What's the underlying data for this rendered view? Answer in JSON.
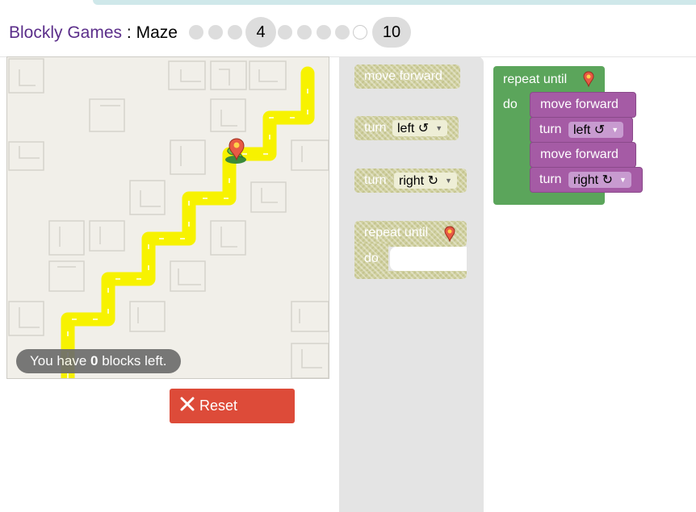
{
  "header": {
    "app_name": "Blockly Games",
    "separator": ":",
    "game_name": "Maze",
    "levels": [
      {
        "label": "",
        "type": "dot"
      },
      {
        "label": "",
        "type": "dot"
      },
      {
        "label": "",
        "type": "dot"
      },
      {
        "label": "4",
        "type": "current"
      },
      {
        "label": "",
        "type": "dot"
      },
      {
        "label": "",
        "type": "dot"
      },
      {
        "label": "",
        "type": "dot"
      },
      {
        "label": "",
        "type": "dot"
      },
      {
        "label": "",
        "type": "ring"
      },
      {
        "label": "10",
        "type": "last"
      }
    ]
  },
  "maze": {
    "capsule": {
      "prefix": "You have",
      "count": "0",
      "suffix": "blocks left."
    },
    "pegman_icon": "pegman-icon",
    "marker_icon": "map-marker-icon"
  },
  "reset_button": {
    "label": "Reset",
    "icon": "close-icon"
  },
  "toolbox": {
    "blocks": [
      {
        "text": "move forward"
      },
      {
        "text": "turn",
        "dropdown": "left ↺"
      },
      {
        "text": "turn",
        "dropdown": "right ↻"
      },
      {
        "text": "repeat until",
        "do": "do"
      }
    ]
  },
  "workspace": {
    "repeat_label": "repeat until",
    "do_label": "do",
    "statements": [
      {
        "text": "move forward"
      },
      {
        "text": "turn",
        "dropdown": "left ↺"
      },
      {
        "text": "move forward"
      },
      {
        "text": "turn",
        "dropdown": "right ↻"
      }
    ]
  },
  "colors": {
    "green_block": "#5ba55b",
    "purple_block": "#a55ba5",
    "path": "#f7f200",
    "reset": "#dd4b39",
    "title_accent": "#5b2e8a"
  }
}
